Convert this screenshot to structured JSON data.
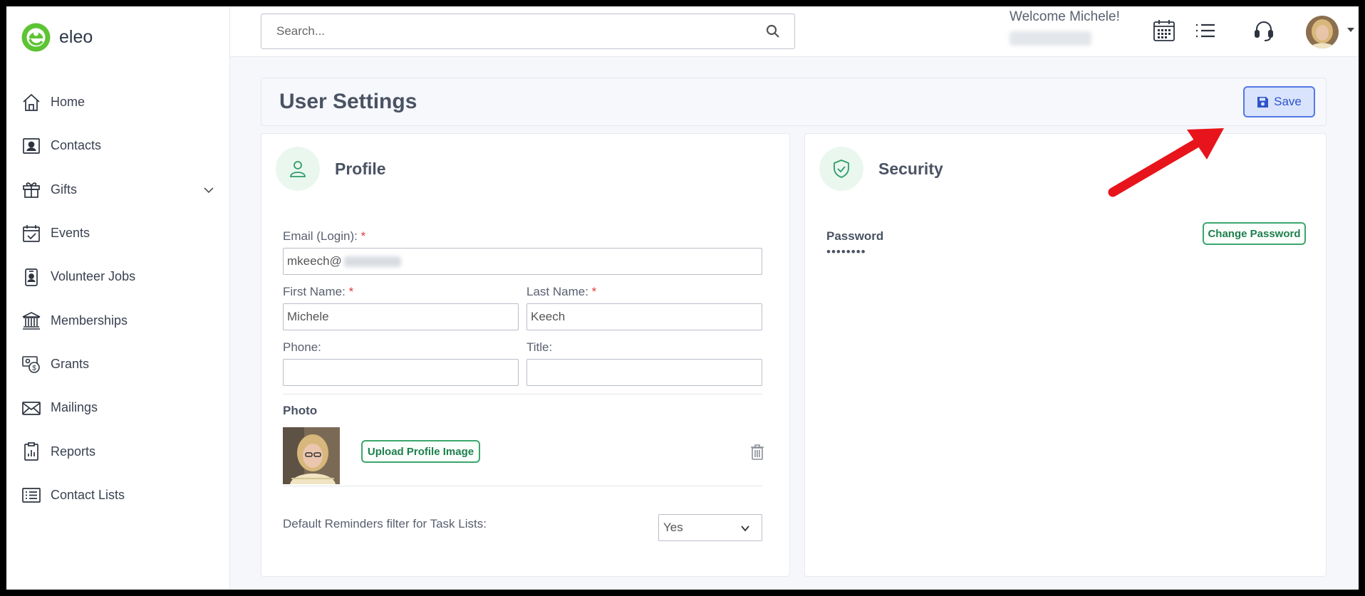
{
  "app": {
    "brand": "eleo",
    "accent": "#5dc434"
  },
  "sidebar": {
    "items": [
      {
        "label": "Home",
        "icon": "home-icon"
      },
      {
        "label": "Contacts",
        "icon": "contacts-icon"
      },
      {
        "label": "Gifts",
        "icon": "gift-icon",
        "expandable": true
      },
      {
        "label": "Events",
        "icon": "calendar-check-icon"
      },
      {
        "label": "Volunteer Jobs",
        "icon": "badge-icon"
      },
      {
        "label": "Memberships",
        "icon": "institution-icon"
      },
      {
        "label": "Grants",
        "icon": "money-icon"
      },
      {
        "label": "Mailings",
        "icon": "envelope-icon"
      },
      {
        "label": "Reports",
        "icon": "clipboard-chart-icon"
      },
      {
        "label": "Contact Lists",
        "icon": "list-icon"
      }
    ]
  },
  "header": {
    "search_placeholder": "Search...",
    "welcome": "Welcome Michele!"
  },
  "page": {
    "title": "User Settings",
    "save_label": "Save"
  },
  "profile": {
    "title": "Profile",
    "email_label": "Email (Login):",
    "email_value": "mkeech@",
    "first_name_label": "First Name:",
    "first_name_value": "Michele",
    "last_name_label": "Last Name:",
    "last_name_value": "Keech",
    "phone_label": "Phone:",
    "phone_value": "",
    "title_label": "Title:",
    "title_value": "",
    "required_mark": "*",
    "photo_label": "Photo",
    "upload_label": "Upload Profile Image",
    "reminders_label": "Default Reminders filter for Task Lists:",
    "reminders_value": "Yes"
  },
  "security": {
    "title": "Security",
    "password_label": "Password",
    "password_mask": "••••••••",
    "change_password_label": "Change Password"
  }
}
